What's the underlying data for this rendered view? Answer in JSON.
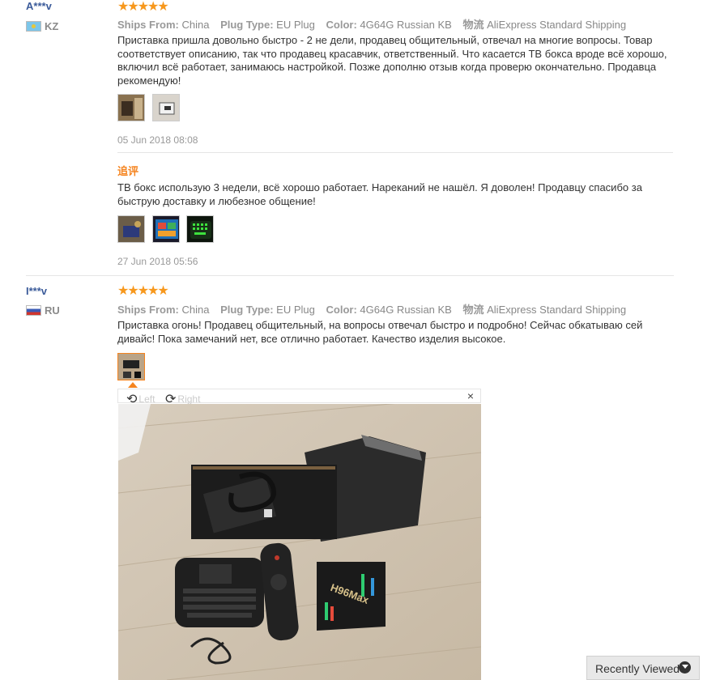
{
  "review1": {
    "user": "A***v",
    "country": "KZ",
    "stars": "★★★★★",
    "ships_from_label": "Ships From:",
    "ships_from": "China",
    "plug_label": "Plug Type:",
    "plug": "EU Plug",
    "color_label": "Color:",
    "color": "4G64G Russian KB",
    "shipping_label": "物流",
    "shipping": "AliExpress Standard Shipping",
    "text": "Приставка пришла довольно быстро - 2 не дели, продавец общительный, отвечал на многие вопросы. Товар соответствует описанию, так что продавец красавчик, ответственный. Что касается ТВ бокса вроде всё хорошо, включил всё работает, занимаюсь настройкой. Позже дополню отзыв когда проверю окончательно. Продавца рекомендую!",
    "date": "05 Jun 2018 08:08",
    "additional_label": "追评",
    "additional_text": "ТВ бокс использую 3 недели, всё хорошо работает. Нареканий не нашёл. Я доволен! Продавцу спасибо за быструю доставку и любезное общение!",
    "additional_date": "27 Jun 2018 05:56"
  },
  "review2": {
    "user": "I***v",
    "country": "RU",
    "stars": "★★★★★",
    "ships_from_label": "Ships From:",
    "ships_from": "China",
    "plug_label": "Plug Type:",
    "plug": "EU Plug",
    "color_label": "Color:",
    "color": "4G64G Russian KB",
    "shipping_label": "物流",
    "shipping": "AliExpress Standard Shipping",
    "text": "Приставка огонь! Продавец общительный, на вопросы отвечал быстро и подробно! Сейчас обкатываю сей дивайс! Пока замечаний нет, все отлично работает. Качество изделия высокое."
  },
  "viewer": {
    "rotate_left": "Left",
    "rotate_right": "Right",
    "close": "×",
    "photo_logo": "H96Max"
  },
  "recently_viewed": "Recently Viewed",
  "colors": {
    "star": "#f7981d",
    "accent": "#f5841f",
    "username": "#3b5b9a"
  }
}
